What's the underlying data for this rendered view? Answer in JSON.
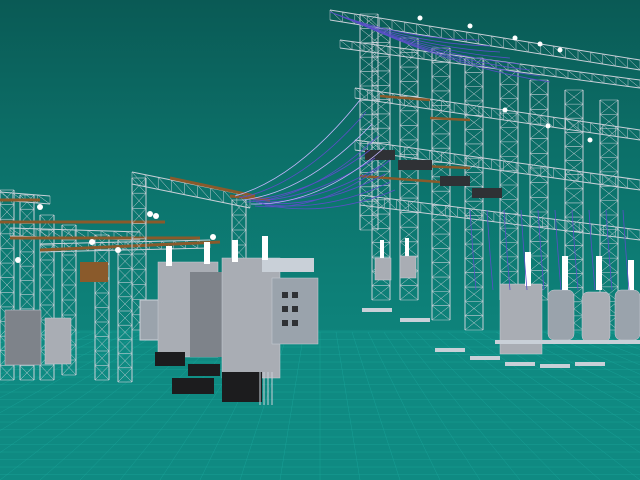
{
  "viewport": {
    "mode": "3d-wireframe-render",
    "colors": {
      "sky_top": "#0a5a55",
      "sky_bottom": "#109088",
      "ground": "#0f8a82",
      "grid": "#1aa59b",
      "steel": "#c9d0d8",
      "steel_dark": "#9aa3ac",
      "wire": "#5a4fc8",
      "wire_alt": "#c6b6ff",
      "bushing_brown": "#8a5a2b",
      "insulator_white": "#ffffff",
      "equipment": "#a9adb4",
      "equipment_dark": "#7e838a",
      "base": "#1c1c1e"
    },
    "objects": [
      {
        "name": "left-gantry-cluster"
      },
      {
        "name": "center-gantry"
      },
      {
        "name": "center-transformer"
      },
      {
        "name": "right-substation-structure"
      },
      {
        "name": "right-transformer-bank"
      },
      {
        "name": "overhead-conductors"
      },
      {
        "name": "ground-grid"
      }
    ]
  }
}
